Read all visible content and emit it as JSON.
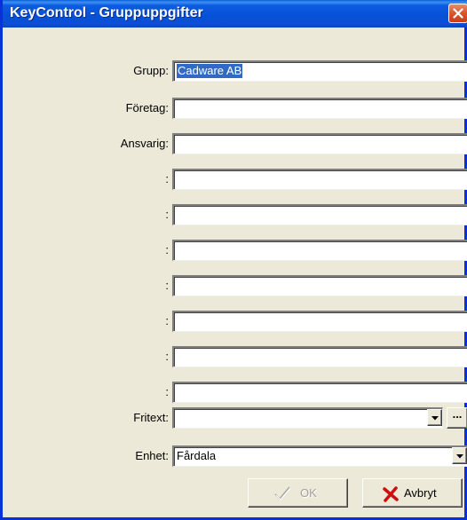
{
  "window": {
    "title": "KeyControl - Gruppuppgifter"
  },
  "colors": {
    "titlebar": "#0750d6",
    "close_button": "#d9552c",
    "face": "#ece9d8",
    "selection": "#316ac5",
    "cancel_icon": "#cc1010"
  },
  "fields": {
    "grupp": {
      "label": "Grupp:",
      "value": "Cadware AB"
    },
    "foretag": {
      "label": "Företag:",
      "value": ""
    },
    "ansvarig": {
      "label": "Ansvarig:",
      "value": ""
    },
    "extra": [
      {
        "label": ":",
        "value": ""
      },
      {
        "label": ":",
        "value": ""
      },
      {
        "label": ":",
        "value": ""
      },
      {
        "label": ":",
        "value": ""
      },
      {
        "label": ":",
        "value": ""
      },
      {
        "label": ":",
        "value": ""
      },
      {
        "label": ":",
        "value": ""
      }
    ],
    "fritext": {
      "label": "Fritext:",
      "value": "",
      "browse_label": "..."
    },
    "enhet": {
      "label": "Enhet:",
      "value": "Fårdala"
    }
  },
  "buttons": {
    "ok": {
      "label": "OK",
      "icon": "checkmark-icon",
      "enabled": false
    },
    "cancel": {
      "label": "Avbryt",
      "icon": "red-x-icon"
    }
  }
}
